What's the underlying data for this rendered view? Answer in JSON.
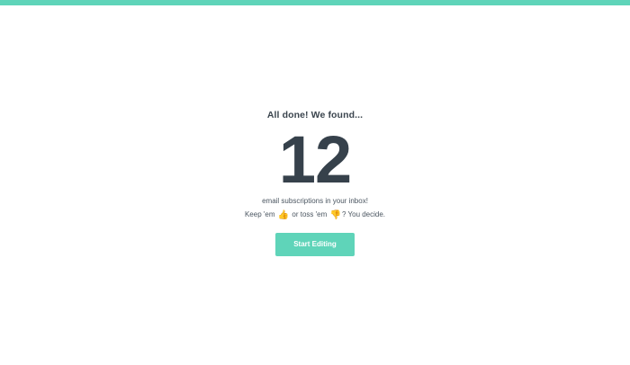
{
  "summary": {
    "headline": "All done! We found...",
    "count": "12",
    "description": "email subscriptions in your inbox!",
    "prompt": {
      "keep": "Keep 'em",
      "keep_emoji": "👍",
      "or_toss": "or toss 'em",
      "toss_emoji": "👎",
      "decide": "? You decide."
    }
  },
  "actions": {
    "start_label": "Start Editing"
  },
  "colors": {
    "accent": "#5fd4b9",
    "text_dark": "#36414b"
  }
}
